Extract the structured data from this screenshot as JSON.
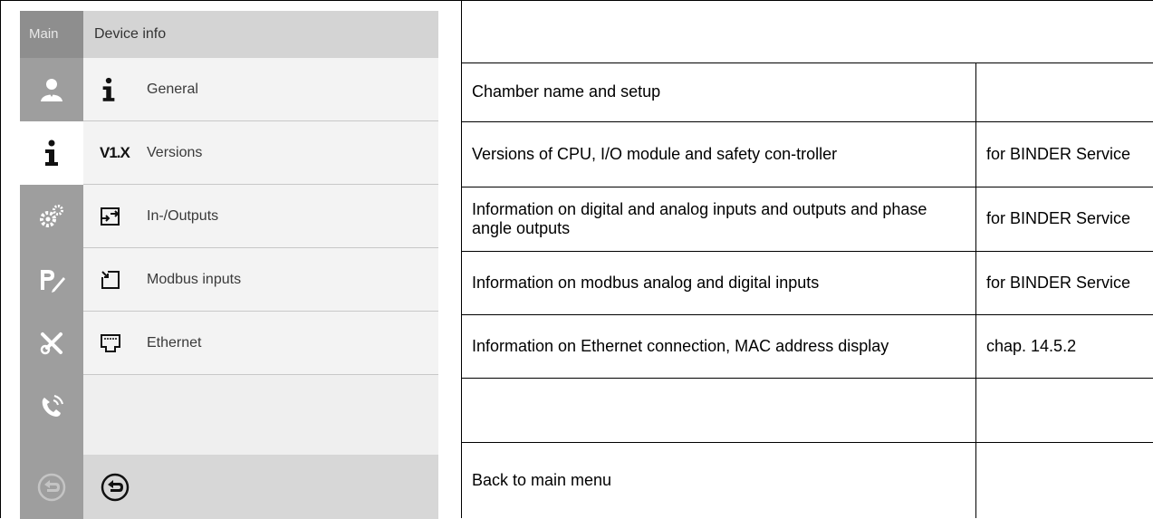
{
  "device": {
    "nav_title": "Main",
    "header_title": "Device info",
    "nav_icons": [
      "user-icon",
      "info-icon",
      "settings-gears-icon",
      "program-edit-icon",
      "tools-icon",
      "service-phone-icon",
      "back-icon"
    ],
    "menu": [
      {
        "label": "General",
        "icon": "info-icon"
      },
      {
        "label": "Versions",
        "icon": "version-icon",
        "icon_text": "V1.X"
      },
      {
        "label": "In-/Outputs",
        "icon": "in-out-icon"
      },
      {
        "label": "Modbus inputs",
        "icon": "modbus-input-icon"
      },
      {
        "label": "Ethernet",
        "icon": "ethernet-icon"
      }
    ],
    "footer_icon": "back-circle-icon",
    "colors": {
      "nav_bg": "#9e9e9e",
      "panel_bg": "#efefef",
      "header_bg": "#d4d4d4",
      "active": "#ffffff"
    }
  },
  "table": {
    "rows": [
      {
        "description": "",
        "reference": ""
      },
      {
        "description": "Chamber name and setup",
        "reference": ""
      },
      {
        "description": "Versions of CPU, I/O module and safety con-troller",
        "reference": "for BINDER Service"
      },
      {
        "description": "Information on digital and analog inputs and outputs and phase angle outputs",
        "reference": "for BINDER Service"
      },
      {
        "description": "Information on modbus analog and digital inputs",
        "reference": "for BINDER Service"
      },
      {
        "description": "Information on Ethernet connection, MAC address display",
        "reference": "chap. 14.5.2"
      },
      {
        "description": "",
        "reference": ""
      },
      {
        "description": "Back to main menu",
        "reference": ""
      }
    ]
  }
}
